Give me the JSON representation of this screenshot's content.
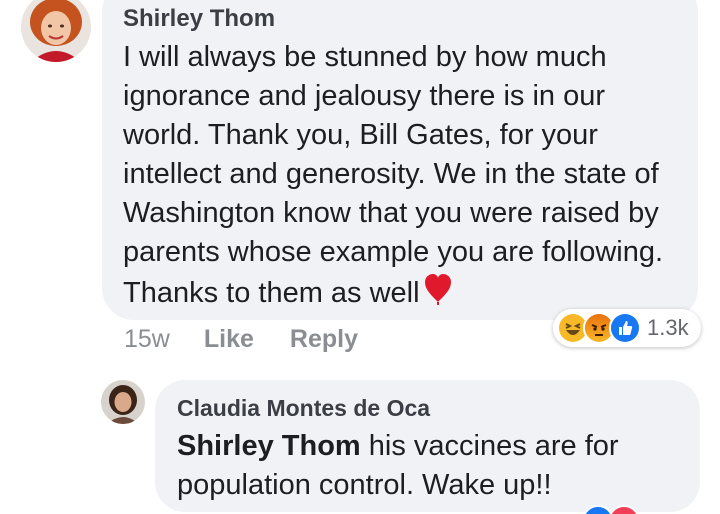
{
  "comments": [
    {
      "author": "Shirley Thom",
      "avatar_icon": "profile-photo-red-hair-woman",
      "text": "I will always be stunned by how much ignorance and jealousy there is in our world. Thank you, Bill Gates, for your intellect and generosity. We in the state of Washington know that you were raised by parents whose example you are following. Thanks to them as well",
      "emoji_icon": "red-heart-emoji",
      "time": "15w",
      "like_label": "Like",
      "reply_label": "Reply",
      "reactions": {
        "icons": [
          "haha-icon",
          "angry-icon",
          "like-icon"
        ],
        "count": "1.3k"
      }
    },
    {
      "author": "Claudia Montes de Oca",
      "avatar_icon": "profile-photo-woman",
      "mention": "Shirley Thom",
      "text": " his vaccines are for population control. Wake up!!",
      "bottom_reactions": [
        "like-icon",
        "love-icon"
      ]
    }
  ],
  "colors": {
    "bubble_bg": "#f0f2f5",
    "meta_text": "#8a8d91",
    "like_blue": "#1877f2",
    "haha_yellow": "#f7b928",
    "angry_orange": "#e9710f",
    "love_red": "#f33e58"
  }
}
